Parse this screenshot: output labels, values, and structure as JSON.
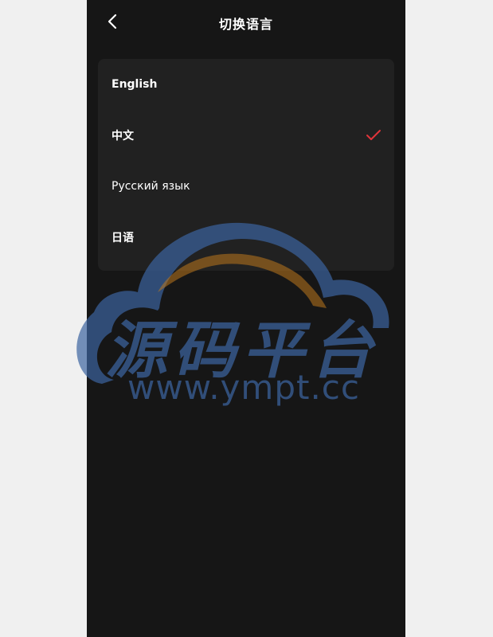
{
  "header": {
    "title": "切换语言",
    "back_icon": "chevron-left-icon"
  },
  "languages": [
    {
      "label": "English",
      "selected": false
    },
    {
      "label": "中文",
      "selected": true
    },
    {
      "label": "Русский язык",
      "selected": false
    },
    {
      "label": "日语",
      "selected": false
    }
  ],
  "check_color": "#e0343a",
  "watermark": {
    "text": "源码平台",
    "url": "www.ympt.cc"
  }
}
